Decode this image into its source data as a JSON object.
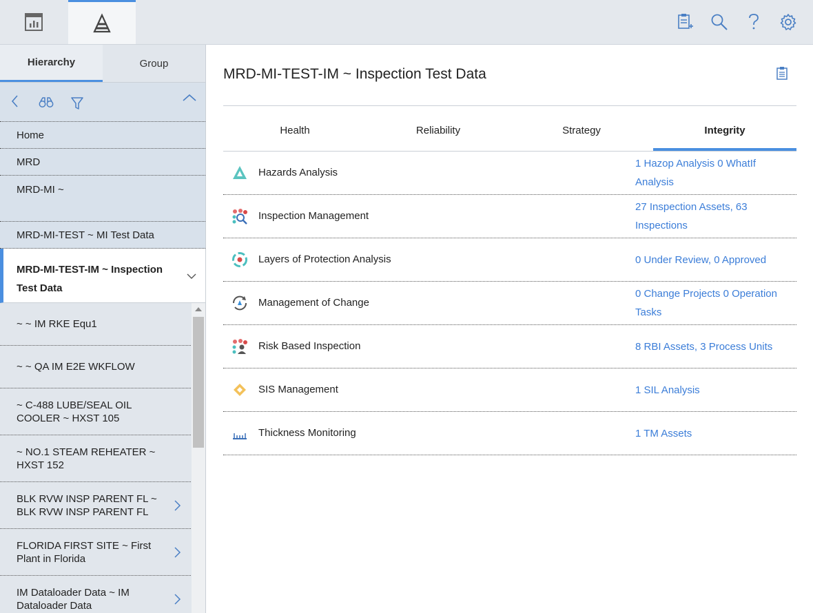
{
  "topbar": {
    "tabs": [
      {
        "icon": "dashboard-icon"
      },
      {
        "icon": "hierarchy-icon",
        "active": true
      }
    ],
    "actions": [
      {
        "icon": "clipboard-add-icon"
      },
      {
        "icon": "search-icon"
      },
      {
        "icon": "help-icon"
      },
      {
        "icon": "gear-icon"
      }
    ]
  },
  "left": {
    "tabs": [
      {
        "label": "Hierarchy",
        "active": true
      },
      {
        "label": "Group",
        "active": false
      }
    ],
    "breadcrumbs": [
      "Home",
      "MRD",
      "MRD-MI ~",
      "MRD-MI-TEST ~ MI Test Data"
    ],
    "current": "MRD-MI-TEST-IM ~ Inspection Test Data",
    "children": [
      {
        "label": "~ ~ IM RKE Equ1",
        "has_children": false
      },
      {
        "label": "~ ~ QA IM E2E WKFLOW",
        "has_children": false
      },
      {
        "label": "~ C-488 LUBE/SEAL OIL COOLER ~ HXST 105",
        "has_children": false
      },
      {
        "label": "~ NO.1 STEAM REHEATER ~ HXST 152",
        "has_children": false
      },
      {
        "label": "BLK RVW INSP PARENT FL ~ BLK RVW INSP PARENT FL",
        "has_children": true
      },
      {
        "label": "FLORIDA FIRST SITE ~ First Plant in Florida",
        "has_children": true
      },
      {
        "label": "IM Dataloader Data ~ IM Dataloader Data",
        "has_children": true
      }
    ]
  },
  "main": {
    "title": "MRD-MI-TEST-IM ~ Inspection Test Data",
    "tabs": [
      {
        "label": "Health",
        "active": false
      },
      {
        "label": "Reliability",
        "active": false
      },
      {
        "label": "Strategy",
        "active": false
      },
      {
        "label": "Integrity",
        "active": true
      }
    ],
    "rows": [
      {
        "icon": "hazards-analysis-icon",
        "name": "Hazards Analysis",
        "summary": "1 Hazop Analysis 0 WhatIf Analysis"
      },
      {
        "icon": "inspection-management-icon",
        "name": "Inspection Management",
        "summary": "27 Inspection Assets, 63 Inspections"
      },
      {
        "icon": "lopa-icon",
        "name": "Layers of Protection Analysis",
        "summary": "0 Under Review, 0 Approved"
      },
      {
        "icon": "management-of-change-icon",
        "name": "Management of Change",
        "summary": "0 Change Projects 0 Operation Tasks"
      },
      {
        "icon": "risk-based-inspection-icon",
        "name": "Risk Based Inspection",
        "summary": "8 RBI Assets, 3 Process Units"
      },
      {
        "icon": "sis-management-icon",
        "name": "SIS Management",
        "summary": "1 SIL Analysis"
      },
      {
        "icon": "thickness-monitoring-icon",
        "name": "Thickness Monitoring",
        "summary": "1 TM Assets"
      }
    ]
  },
  "colors": {
    "accent": "#4a8fe0",
    "link": "#3b7dd8",
    "panel": "#e1e6ec"
  }
}
